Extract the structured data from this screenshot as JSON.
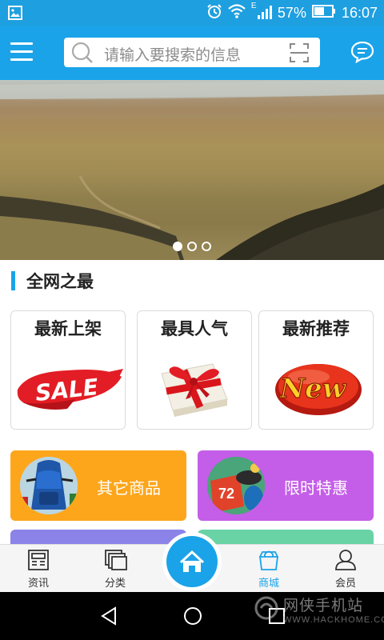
{
  "status_bar": {
    "battery": "57%",
    "time": "16:07",
    "network_label": "E",
    "icons": [
      "gallery-icon",
      "alarm-icon",
      "wifi-icon",
      "signal-icon",
      "battery-icon"
    ]
  },
  "header": {
    "search_placeholder": "请输入要搜索的信息",
    "menu_icon": "menu-icon",
    "scan_icon": "scan-icon",
    "message_icon": "message-icon"
  },
  "banner": {
    "slide_count": 3,
    "active_slide": 1
  },
  "section": {
    "title": "全网之最"
  },
  "cards": [
    {
      "title": "最新上架",
      "image": "SALE"
    },
    {
      "title": "最具人气",
      "image": "gift-box-icon"
    },
    {
      "title": "最新推荐",
      "image": "New"
    }
  ],
  "tiles": [
    {
      "label": "其它商品",
      "color": "#fda61c"
    },
    {
      "label": "限时特惠",
      "color": "#c45ee8"
    }
  ],
  "tabbar": {
    "items": [
      {
        "label": "资讯",
        "icon": "news-icon"
      },
      {
        "label": "分类",
        "icon": "category-icon"
      },
      {
        "label": "",
        "icon": "home-icon"
      },
      {
        "label": "商城",
        "icon": "shopping-bag-icon",
        "active": true
      },
      {
        "label": "会员",
        "icon": "user-icon"
      }
    ]
  },
  "watermark": {
    "cn": "网侠手机站",
    "en": "WWW.HACKHOME.COM"
  },
  "colors": {
    "brand_blue": "#1aa3e8",
    "orange_tile": "#fda61c",
    "purple_tile": "#c45ee8"
  }
}
